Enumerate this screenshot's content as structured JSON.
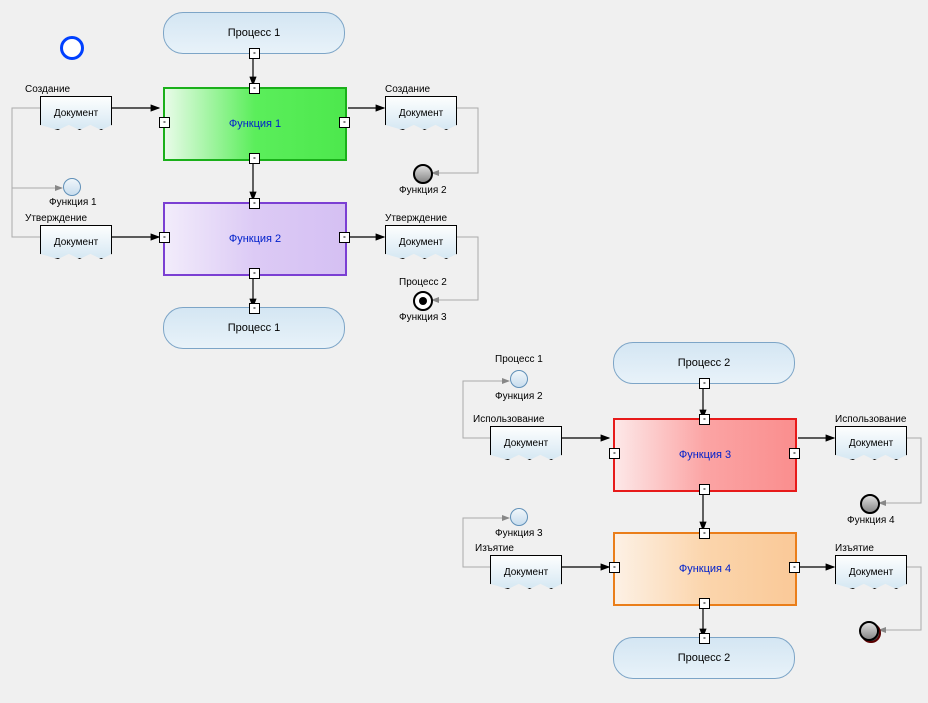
{
  "processes": {
    "p1_top": "Процесс 1",
    "p1_bottom": "Процесс 1",
    "p2_top": "Процесс 2",
    "p2_bottom": "Процесс 2"
  },
  "functions": {
    "f1": "Функция 1",
    "f2": "Функция 2",
    "f3": "Функция 3",
    "f4": "Функция 4"
  },
  "documents": {
    "doc": "Документ"
  },
  "labels": {
    "creation": "Создание",
    "approval": "Утверждение",
    "usage": "Использование",
    "withdrawal": "Изъятие",
    "func1": "Функция 1",
    "func2": "Функция 2",
    "func3": "Функция 3",
    "func4": "Функция 4",
    "proc1": "Процесс 1",
    "proc2": "Процесс 2"
  },
  "handle": "-"
}
